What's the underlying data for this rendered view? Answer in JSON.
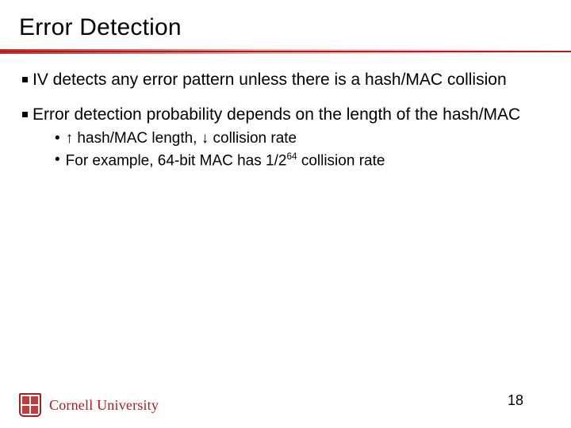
{
  "title": "Error Detection",
  "bullets": [
    {
      "text": "IV detects any error pattern unless there is a hash/MAC collision"
    },
    {
      "text": "Error detection probability depends on the length of the hash/MAC",
      "sub": [
        {
          "text": "↑ hash/MAC length, ↓ collision rate"
        },
        {
          "prefix": "For example, 64-bit MAC has 1/2",
          "exp": "64",
          "suffix": " collision rate"
        }
      ]
    }
  ],
  "footer": {
    "org": "Cornell University",
    "page": "18"
  },
  "colors": {
    "accent": "#b31b1b"
  }
}
